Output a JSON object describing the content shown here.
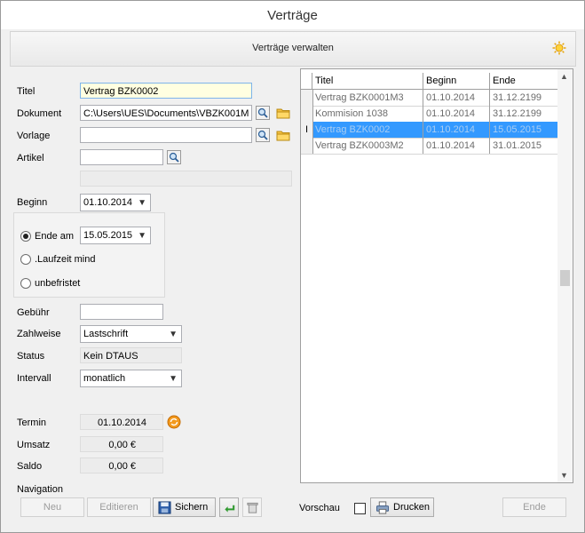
{
  "window": {
    "title": "Verträge"
  },
  "header": {
    "title": "Verträge verwalten"
  },
  "form": {
    "titel": {
      "label": "Titel",
      "value": "Vertrag BZK0002"
    },
    "dokument": {
      "label": "Dokument",
      "value": "C:\\Users\\UES\\Documents\\VBZK001M"
    },
    "vorlage": {
      "label": "Vorlage",
      "value": ""
    },
    "artikel": {
      "label": "Artikel",
      "value": "",
      "value2": ""
    },
    "beginn": {
      "label": "Beginn",
      "value": "01.10.2014"
    },
    "ende": {
      "options": [
        {
          "label": "Ende am",
          "selected": true
        },
        {
          "label": ".Laufzeit mind",
          "selected": false
        },
        {
          "label": "unbefristet",
          "selected": false
        }
      ],
      "date": "15.05.2015"
    },
    "gebuehr": {
      "label": "Gebühr",
      "value": ""
    },
    "zahlweise": {
      "label": "Zahlweise",
      "value": "Lastschrift"
    },
    "status": {
      "label": "Status",
      "value": "Kein DTAUS"
    },
    "intervall": {
      "label": "Intervall",
      "value": "monatlich"
    },
    "termin": {
      "label": "Termin",
      "value": "01.10.2014"
    },
    "umsatz": {
      "label": "Umsatz",
      "value": "0,00 €"
    },
    "saldo": {
      "label": "Saldo",
      "value": "0,00 €"
    }
  },
  "table": {
    "columns": [
      "Titel",
      "Beginn",
      "Ende"
    ],
    "rows": [
      {
        "titel": "Vertrag BZK0001M3",
        "beginn": "01.10.2014",
        "ende": "31.12.2199",
        "selected": false
      },
      {
        "titel": "Kommision 1038",
        "beginn": "01.10.2014",
        "ende": "31.12.2199",
        "selected": false
      },
      {
        "titel": "Vertrag BZK0002",
        "beginn": "01.10.2014",
        "ende": "15.05.2015",
        "selected": true
      },
      {
        "titel": "Vertrag BZK0003M2",
        "beginn": "01.10.2014",
        "ende": "31.01.2015",
        "selected": false
      }
    ]
  },
  "navigation": {
    "label": "Navigation",
    "neu": "Neu",
    "editieren": "Editieren",
    "sichern": "Sichern",
    "vorschau": "Vorschau",
    "drucken": "Drucken",
    "ende": "Ende"
  },
  "colors": {
    "selection": "#3399ff",
    "focus_input": "#ffffe1"
  }
}
